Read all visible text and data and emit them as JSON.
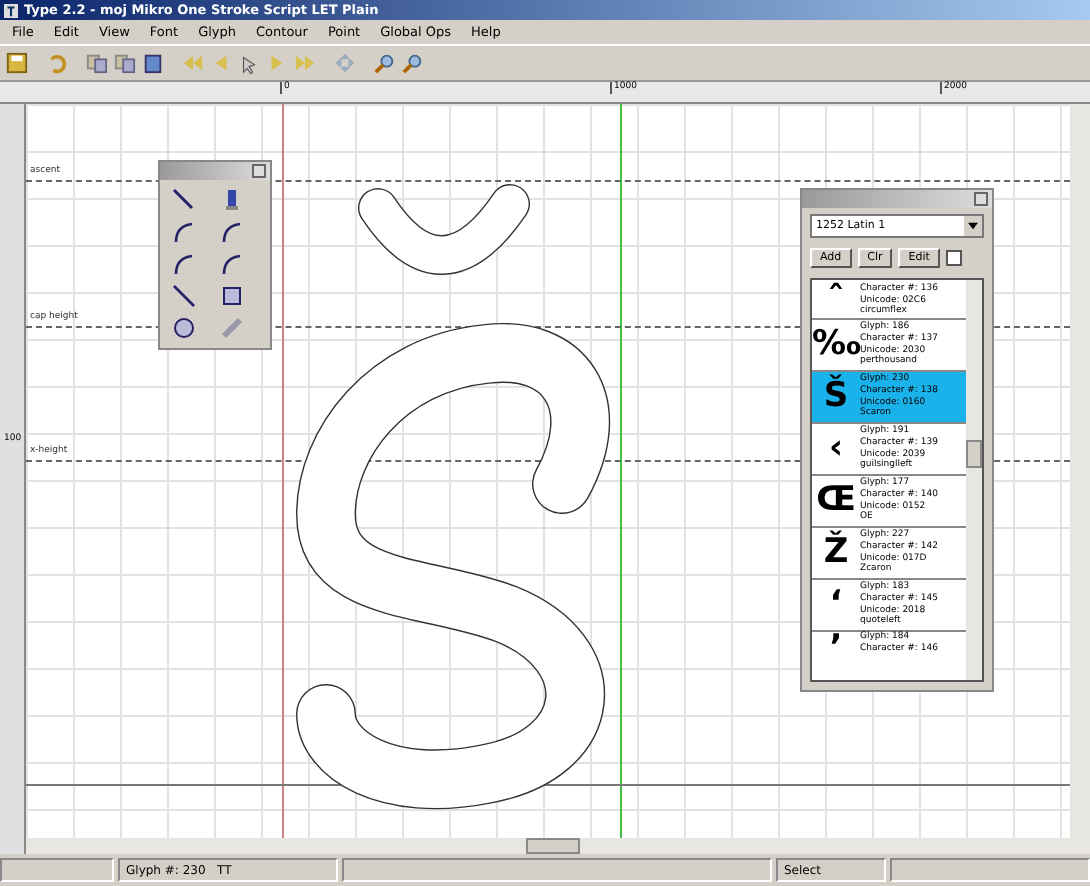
{
  "window": {
    "title": "Type 2.2  -  moj Mikro One Stroke Script LET Plain"
  },
  "menu": [
    "File",
    "Edit",
    "View",
    "Font",
    "Glyph",
    "Contour",
    "Point",
    "Global Ops",
    "Help"
  ],
  "ruler": {
    "marks": [
      "0",
      "1000",
      "2000"
    ],
    "side_mark": "100"
  },
  "metric_lines": [
    "ascent",
    "cap height",
    "x-height"
  ],
  "glyph_panel": {
    "codepage": "1252 Latin 1",
    "buttons": [
      "Add",
      "Clr",
      "Edit"
    ],
    "checked": false,
    "items": [
      {
        "char": "ˆ",
        "lines": [
          "Character #: 136",
          "Unicode: 02C6",
          "circumflex"
        ],
        "selected": false
      },
      {
        "char": "‰",
        "lines": [
          "Glyph: 186",
          "Character #: 137",
          "Unicode: 2030",
          "perthousand"
        ],
        "selected": false
      },
      {
        "char": "Š",
        "lines": [
          "Glyph: 230",
          "Character #: 138",
          "Unicode: 0160",
          "Scaron"
        ],
        "selected": true
      },
      {
        "char": "‹",
        "lines": [
          "Glyph: 191",
          "Character #: 139",
          "Unicode: 2039",
          "guilsinglleft"
        ],
        "selected": false
      },
      {
        "char": "Œ",
        "lines": [
          "Glyph: 177",
          "Character #: 140",
          "Unicode: 0152",
          "OE"
        ],
        "selected": false
      },
      {
        "char": "Ž",
        "lines": [
          "Glyph: 227",
          "Character #: 142",
          "Unicode: 017D",
          "Zcaron"
        ],
        "selected": false
      },
      {
        "char": "‘",
        "lines": [
          "Glyph: 183",
          "Character #: 145",
          "Unicode: 2018",
          "quoteleft"
        ],
        "selected": false
      },
      {
        "char": "’",
        "lines": [
          "Glyph: 184",
          "Character #: 146"
        ],
        "selected": false
      }
    ]
  },
  "status_bar": {
    "glyph": "Glyph #: 230",
    "format": "TT",
    "mode": "Select"
  }
}
